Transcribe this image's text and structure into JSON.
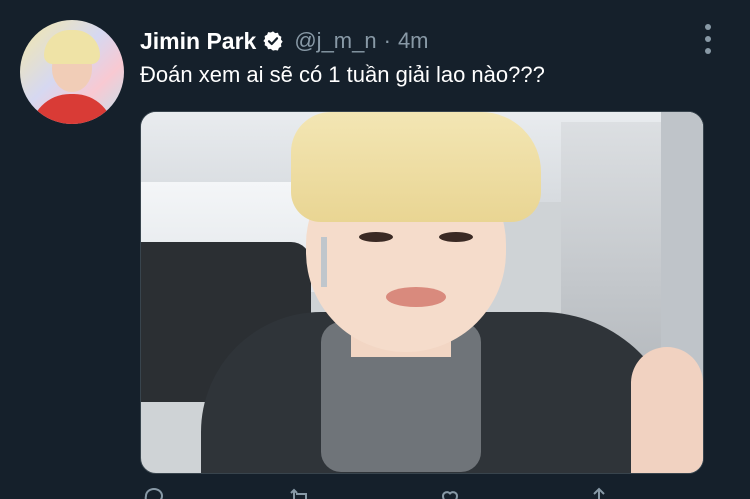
{
  "tweet": {
    "author_name": "Jimin Park",
    "handle": "@j_m_n",
    "separator": "·",
    "time": "4m",
    "text": "Đoán xem ai sẽ có 1 tuần giải lao nào???"
  },
  "colors": {
    "background": "#15202b",
    "secondary_text": "#8899a6",
    "primary_text": "#ffffff",
    "border": "#38444d"
  },
  "icons": {
    "verified": "verified-badge-icon",
    "more": "more-options-icon",
    "reply": "reply-icon",
    "retweet": "retweet-icon",
    "like": "like-icon",
    "share": "share-icon"
  }
}
